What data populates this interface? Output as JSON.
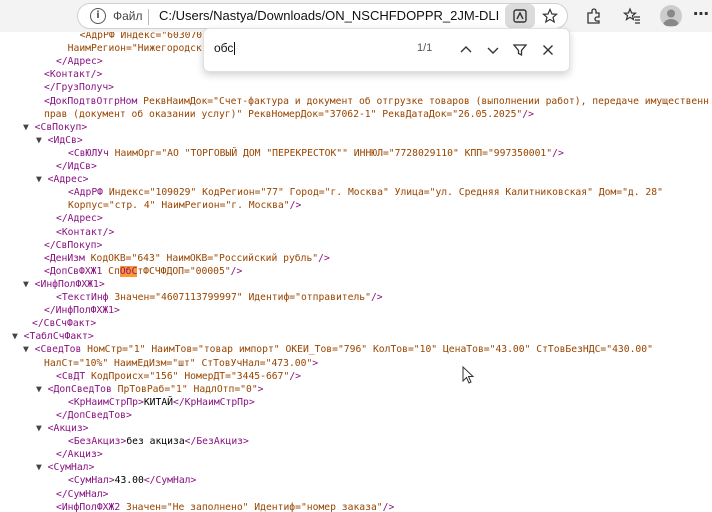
{
  "browser": {
    "scheme_label": "Файл",
    "url": "C:/Users/Nastya/Downloads/ON_NSCHFDOPPR_2JM-DLINK-95..."
  },
  "find": {
    "query": "обс",
    "count": "1/1"
  },
  "xml_lines": [
    [
      [
        "attr",
        "  <АдрРФ Индекс=\"603070\""
      ],
      [
        "tag",
        "                                      "
      ],
      [
        "attr",
        "  Дом=\"10\" Корпус=\"Б\""
      ]
    ],
    [
      [
        "attr",
        "  НаимРегион=\"Нижегородск"
      ]
    ],
    [
      [
        "tag",
        "</Адрес>"
      ]
    ],
    [
      [
        "tag",
        "<Контакт/>"
      ]
    ],
    [
      [
        "tag",
        "</ГрузПолуч>"
      ]
    ],
    [
      [
        "tag",
        "<ДокПодтвОтгрНом "
      ],
      [
        "attr",
        "РеквНаимДок=\"Счет-фактура и документ об отгрузке товаров (выполнении работ), передаче имущественн"
      ]
    ],
    [
      [
        "attr",
        "прав (документ об оказании услуг)\" РеквНомерДок=\"37062-1\" РеквДатаДок=\"26.05.2025\""
      ],
      [
        "tag",
        "/>"
      ]
    ],
    [
      [
        "tog",
        "▼ "
      ],
      [
        "tag",
        "<СвПокуп>"
      ]
    ],
    [
      [
        "tog",
        "▼ "
      ],
      [
        "tag",
        "<ИдСв>"
      ]
    ],
    [
      [
        "tag",
        "<СвЮЛУч "
      ],
      [
        "attr",
        "НаимОрг=\"АО \"ТОРГОВЫЙ ДОМ \"ПЕРЕКРЕСТОК\"\" ИННЮЛ=\"7728029110\" КПП=\"997350001\""
      ],
      [
        "tag",
        "/>"
      ]
    ],
    [
      [
        "tag",
        "</ИдСв>"
      ]
    ],
    [
      [
        "tog",
        "▼ "
      ],
      [
        "tag",
        "<Адрес>"
      ]
    ],
    [
      [
        "tag",
        "<АдрРФ "
      ],
      [
        "attr",
        "Индекс=\"109029\" КодРегион=\"77\" Город=\"г. Москва\" Улица=\"ул. Средняя Калитниковская\" Дом=\"д. 28\""
      ]
    ],
    [
      [
        "attr",
        "Корпус=\"стр. 4\" НаимРегион=\"г. Москва\""
      ],
      [
        "tag",
        "/>"
      ]
    ],
    [
      [
        "tag",
        "</Адрес>"
      ]
    ],
    [
      [
        "tag",
        "<Контакт/>"
      ]
    ],
    [
      [
        "tag",
        "</СвПокуп>"
      ]
    ],
    [
      [
        "tag",
        "<ДенИзм "
      ],
      [
        "attr",
        "КодОКВ=\"643\" НаимОКВ=\"Российский рубль\""
      ],
      [
        "tag",
        "/>"
      ]
    ],
    [
      [
        "tag",
        "<ДопСвФХЖ1 "
      ],
      [
        "attr",
        "Сп"
      ],
      [
        "hl",
        "ОбС"
      ],
      [
        "attr",
        "тФСЧФДОП=\"00005\""
      ],
      [
        "tag",
        "/>"
      ]
    ],
    [
      [
        "tog",
        "▼ "
      ],
      [
        "tag",
        "<ИнфПолФХЖ1>"
      ]
    ],
    [
      [
        "tag",
        "<ТекстИнф "
      ],
      [
        "attr",
        "Значен=\"4607113799997\" Идентиф=\"отправитель\""
      ],
      [
        "tag",
        "/>"
      ]
    ],
    [
      [
        "tag",
        "</ИнфПолФХЖ1>"
      ]
    ],
    [
      [
        "tag",
        "</СвСчФакт>"
      ]
    ],
    [
      [
        "tog",
        "▼ "
      ],
      [
        "tag",
        "<ТаблСчФакт>"
      ]
    ],
    [
      [
        "tog",
        "▼ "
      ],
      [
        "tag",
        "<СведТов "
      ],
      [
        "attr",
        "НомСтр=\"1\" НаимТов=\"товар импорт\" ОКЕИ_Тов=\"796\" КолТов=\"10\" ЦенаТов=\"43.00\" СтТовБезНДС=\"430.00\""
      ]
    ],
    [
      [
        "attr",
        "НалСт=\"10%\" НаимЕдИзм=\"шт\" СтТовУчНал=\"473.00\""
      ],
      [
        "tag",
        ">"
      ]
    ],
    [
      [
        "tag",
        "<СвДТ "
      ],
      [
        "attr",
        "КодПроисх=\"156\" НомерДТ=\"3445-667\""
      ],
      [
        "tag",
        "/>"
      ]
    ],
    [
      [
        "tog",
        "▼ "
      ],
      [
        "tag",
        "<ДопСведТов "
      ],
      [
        "attr",
        "ПрТовРаб=\"1\" НадлОтп=\"0\""
      ],
      [
        "tag",
        ">"
      ]
    ],
    [
      [
        "tag",
        "<КрНаимСтрПр>"
      ],
      [
        "txt",
        "КИТАЙ"
      ],
      [
        "tag",
        "</КрНаимСтрПр>"
      ]
    ],
    [
      [
        "tag",
        "</ДопСведТов>"
      ]
    ],
    [
      [
        "tog",
        "▼ "
      ],
      [
        "tag",
        "<Акциз>"
      ]
    ],
    [
      [
        "tag",
        "<БезАкциз>"
      ],
      [
        "txt",
        "без акциза"
      ],
      [
        "tag",
        "</БезАкциз>"
      ]
    ],
    [
      [
        "tag",
        "</Акциз>"
      ]
    ],
    [
      [
        "tog",
        "▼ "
      ],
      [
        "tag",
        "<СумНал>"
      ]
    ],
    [
      [
        "tag",
        "<СумНал>"
      ],
      [
        "txt",
        "43.00"
      ],
      [
        "tag",
        "</СумНал>"
      ]
    ],
    [
      [
        "tag",
        "</СумНал>"
      ]
    ],
    [
      [
        "tag",
        "<ИнфПолФХЖ2 "
      ],
      [
        "attr",
        "Значен=\"Не заполнено\" Идентиф=\"номер_заказа\""
      ],
      [
        "tag",
        "/>"
      ]
    ]
  ]
}
